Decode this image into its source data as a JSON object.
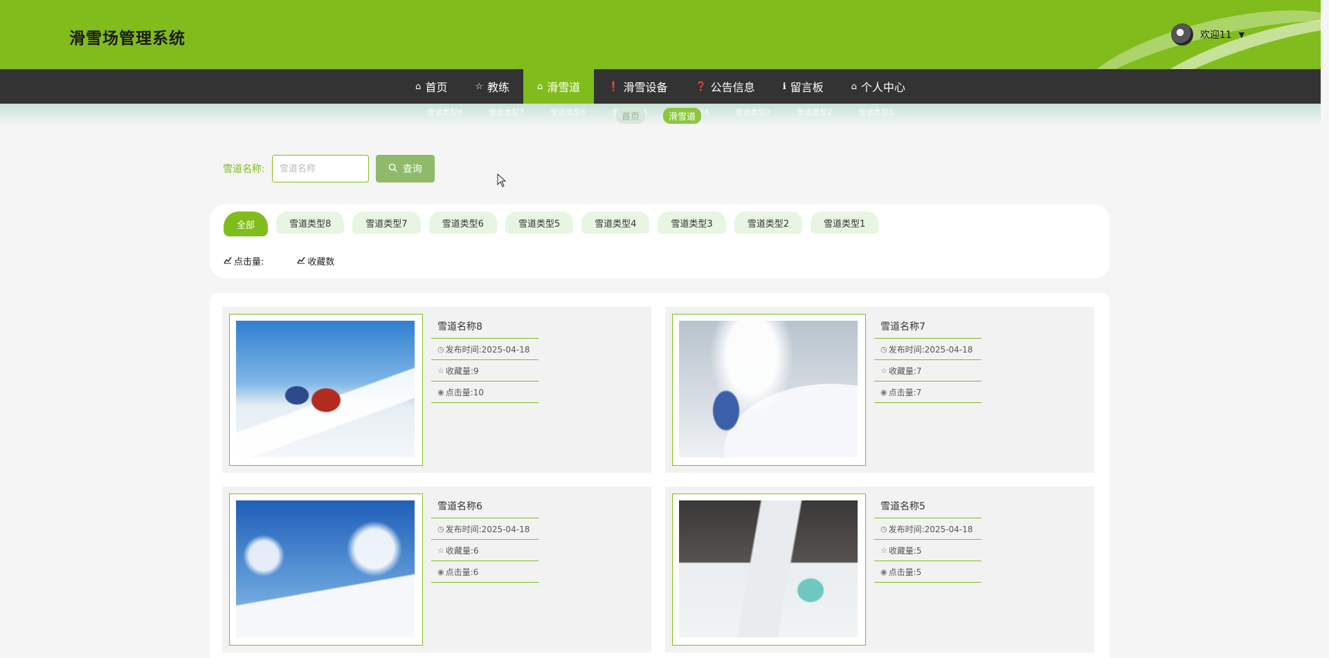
{
  "header": {
    "site_title": "滑雪场管理系统",
    "user": {
      "welcome": "欢迎11",
      "caret": "▼"
    },
    "brand_color": "#80bd1c"
  },
  "nav": {
    "items": [
      {
        "icon": "home-icon",
        "glyph": "⌂",
        "label": "首页"
      },
      {
        "icon": "star-icon",
        "glyph": "☆",
        "label": "教练"
      },
      {
        "icon": "bag-icon",
        "glyph": "⌂",
        "label": "滑雪道"
      },
      {
        "icon": "alert-icon",
        "glyph": "❗",
        "label": "滑雪设备"
      },
      {
        "icon": "question-icon",
        "glyph": "❓",
        "label": "公告信息"
      },
      {
        "icon": "info-icon",
        "glyph": "ℹ",
        "label": "留言板"
      },
      {
        "icon": "home-icon",
        "glyph": "⌂",
        "label": "个人中心"
      }
    ],
    "active_index": 2
  },
  "breadcrumb": {
    "ghost_items": [
      "雪道类型8",
      "雪道类型7",
      "雪道类型6",
      "雪道类型5",
      "雪道类型4",
      "雪道类型3",
      "雪道类型2",
      "雪道类型1"
    ],
    "home": "首页",
    "current": "滑雪道"
  },
  "search": {
    "label": "雪道名称:",
    "placeholder": "雪道名称",
    "button": "查询"
  },
  "filter": {
    "tabs": [
      "全部",
      "雪道类型8",
      "雪道类型7",
      "雪道类型6",
      "雪道类型5",
      "雪道类型4",
      "雪道类型3",
      "雪道类型2",
      "雪道类型1"
    ],
    "active_tab": 0,
    "sorts": [
      {
        "icon": "chart-icon",
        "label": "点击量:"
      },
      {
        "icon": "chart-icon",
        "label": "收藏数"
      }
    ]
  },
  "list": {
    "items": [
      {
        "name": "雪道名称8",
        "publish": "发布时间:2025-04-18",
        "favorites": "收藏量:9",
        "clicks": "点击量:10"
      },
      {
        "name": "雪道名称7",
        "publish": "发布时间:2025-04-18",
        "favorites": "收藏量:7",
        "clicks": "点击量:7"
      },
      {
        "name": "雪道名称6",
        "publish": "发布时间:2025-04-18",
        "favorites": "收藏量:6",
        "clicks": "点击量:6"
      },
      {
        "name": "雪道名称5",
        "publish": "发布时间:2025-04-18",
        "favorites": "收藏量:5",
        "clicks": "点击量:5"
      }
    ]
  }
}
